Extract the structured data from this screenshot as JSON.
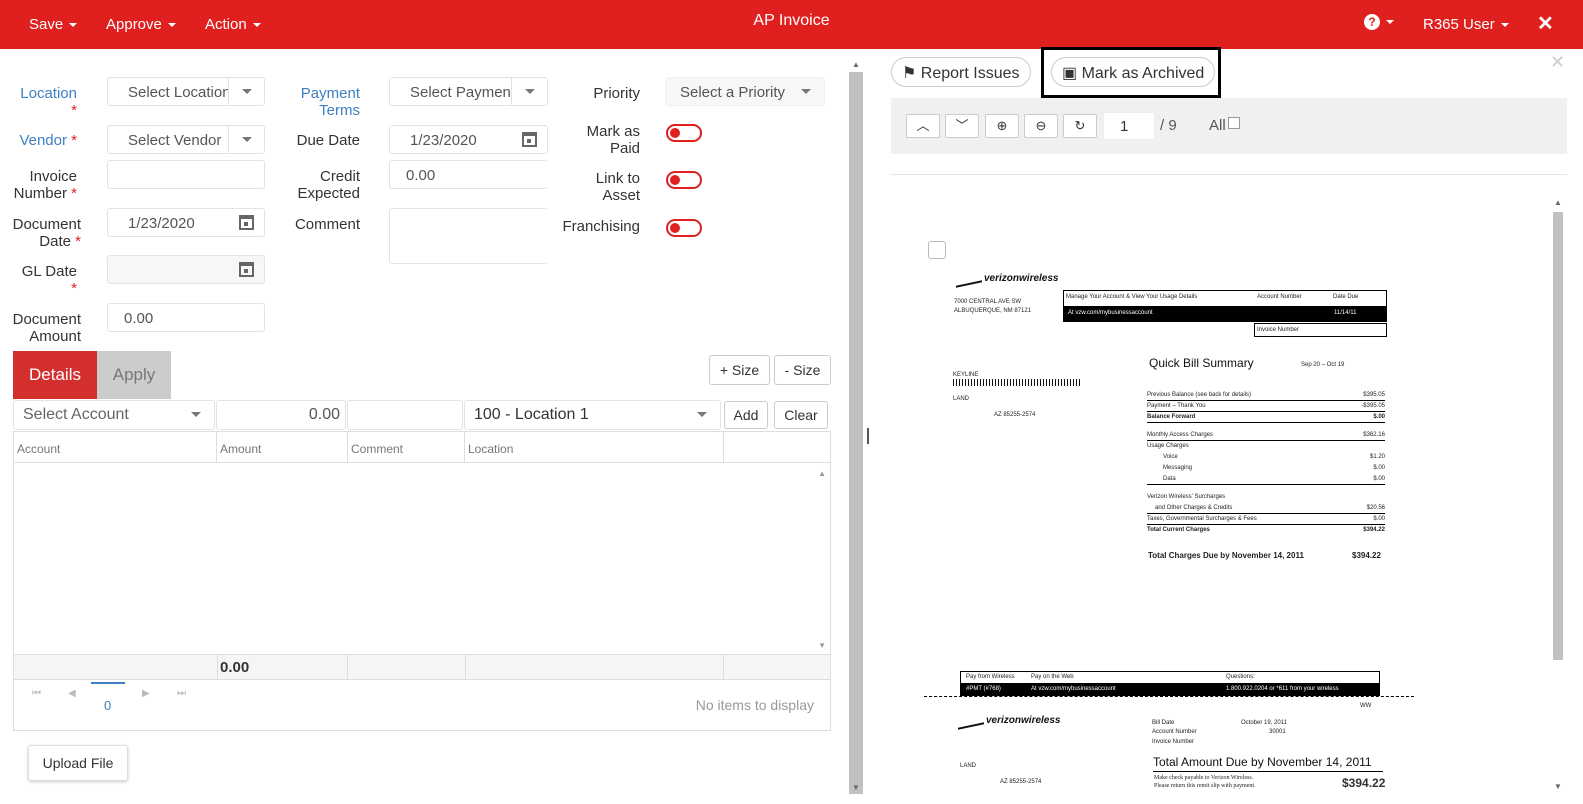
{
  "header": {
    "title": "AP Invoice",
    "menus": [
      "Save",
      "Approve",
      "Action"
    ],
    "user": "R365 User"
  },
  "form": {
    "location_label": "Location",
    "location_placeholder": "Select Location",
    "vendor_label": "Vendor",
    "vendor_placeholder": "Select Vendor",
    "invoice_number_label_1": "Invoice",
    "invoice_number_label_2": "Number",
    "document_date_label_1": "Document",
    "document_date_label_2": "Date",
    "document_date": "1/23/2020",
    "gl_date_label": "GL Date",
    "document_amount_label_1": "Document",
    "document_amount_label_2": "Amount",
    "document_amount": "0.00",
    "payment_terms_label_1": "Payment",
    "payment_terms_label_2": "Terms",
    "payment_terms_placeholder": "Select Payment",
    "due_date_label": "Due Date",
    "due_date": "1/23/2020",
    "credit_expected_label_1": "Credit",
    "credit_expected_label_2": "Expected",
    "credit_expected": "0.00",
    "comment_label": "Comment",
    "priority_label": "Priority",
    "priority_placeholder": "Select a Priority",
    "mark_as_paid_label_1": "Mark as",
    "mark_as_paid_label_2": "Paid",
    "link_to_asset_label_1": "Link to",
    "link_to_asset_label_2": "Asset",
    "franchising_label": "Franchising",
    "required_mark": "*"
  },
  "tabs": {
    "details": "Details",
    "apply": "Apply",
    "size_plus": "+ Size",
    "size_minus": "- Size"
  },
  "entry": {
    "account_placeholder": "Select Account",
    "amount": "0.00",
    "location": "100 - Location 1",
    "add": "Add",
    "clear": "Clear"
  },
  "grid": {
    "columns": [
      "Account",
      "Amount",
      "Comment",
      "Location"
    ],
    "total": "0.00",
    "page": "0",
    "empty": "No items to display"
  },
  "upload": "Upload File",
  "viewer": {
    "report_issues": "Report Issues",
    "mark_archived": "Mark as Archived",
    "page_input": "1",
    "page_total": "/ 9",
    "all_label": "All"
  },
  "document": {
    "brand": "verizonwireless",
    "address_1": "7000 CENTRAL AVE SW",
    "address_2": "ALBUQUERQUE, NM 87121",
    "manage_text": "Manage Your Account & View Your Usage Details",
    "account_number_label": "Account Number",
    "date_due_label": "Date Due",
    "url": "At vzw.com/mybusinessaccount",
    "date_due": "11/14/11",
    "invoice_number_label": "Invoice Number",
    "keyline": "KEYLINE",
    "land": "LAND",
    "zip_line": "AZ 85255-2574",
    "summary_title": "Quick Bill Summary",
    "period": "Sep 20 – Oct 19",
    "rows": [
      {
        "label": "Previous Balance (see back for details)",
        "value": "$395.05"
      },
      {
        "label": "Payment – Thank You",
        "value": "-$395.05"
      },
      {
        "label": "Balance Forward",
        "value": "$.00"
      },
      {
        "label": "Monthly Access Charges",
        "value": "$362.16"
      },
      {
        "label": "Usage Charges",
        "value": ""
      },
      {
        "label": "Voice",
        "value": "$1.20"
      },
      {
        "label": "Messaging",
        "value": "$.00"
      },
      {
        "label": "Data",
        "value": "$.00"
      },
      {
        "label": "Verizon Wireless' Surcharges",
        "value": ""
      },
      {
        "label": "and Other Charges & Credits",
        "value": "$20.56"
      },
      {
        "label": "Taxes, Governmental Surcharges & Fees",
        "value": "$.00"
      },
      {
        "label": "Total Current Charges",
        "value": "$394.22"
      }
    ],
    "total_due_label": "Total Charges Due by November 14, 2011",
    "total_due": "$394.22",
    "slip_pay_wireless": "Pay from Wireless",
    "slip_pay_web": "Pay on the Web",
    "slip_questions": "Questions:",
    "slip_fmt": "#PMT (#768)",
    "slip_url": "At vzw.com/mybusinessaccount",
    "slip_phone": "1.800.922.0204 or *611 from your wireless",
    "slip_ww": "WW",
    "bill_date_label": "Bill Date",
    "bill_date": "October 19, 2011",
    "account_number_label2": "Account Number",
    "account_number_value": "30001",
    "invoice_number_label2": "Invoice Number",
    "amount_due_title": "Total Amount Due by November 14, 2011",
    "payable_1": "Make check payable to Verizon Wireless.",
    "payable_2": "Please return this remit slip with payment.",
    "amount_due": "$394.22"
  }
}
